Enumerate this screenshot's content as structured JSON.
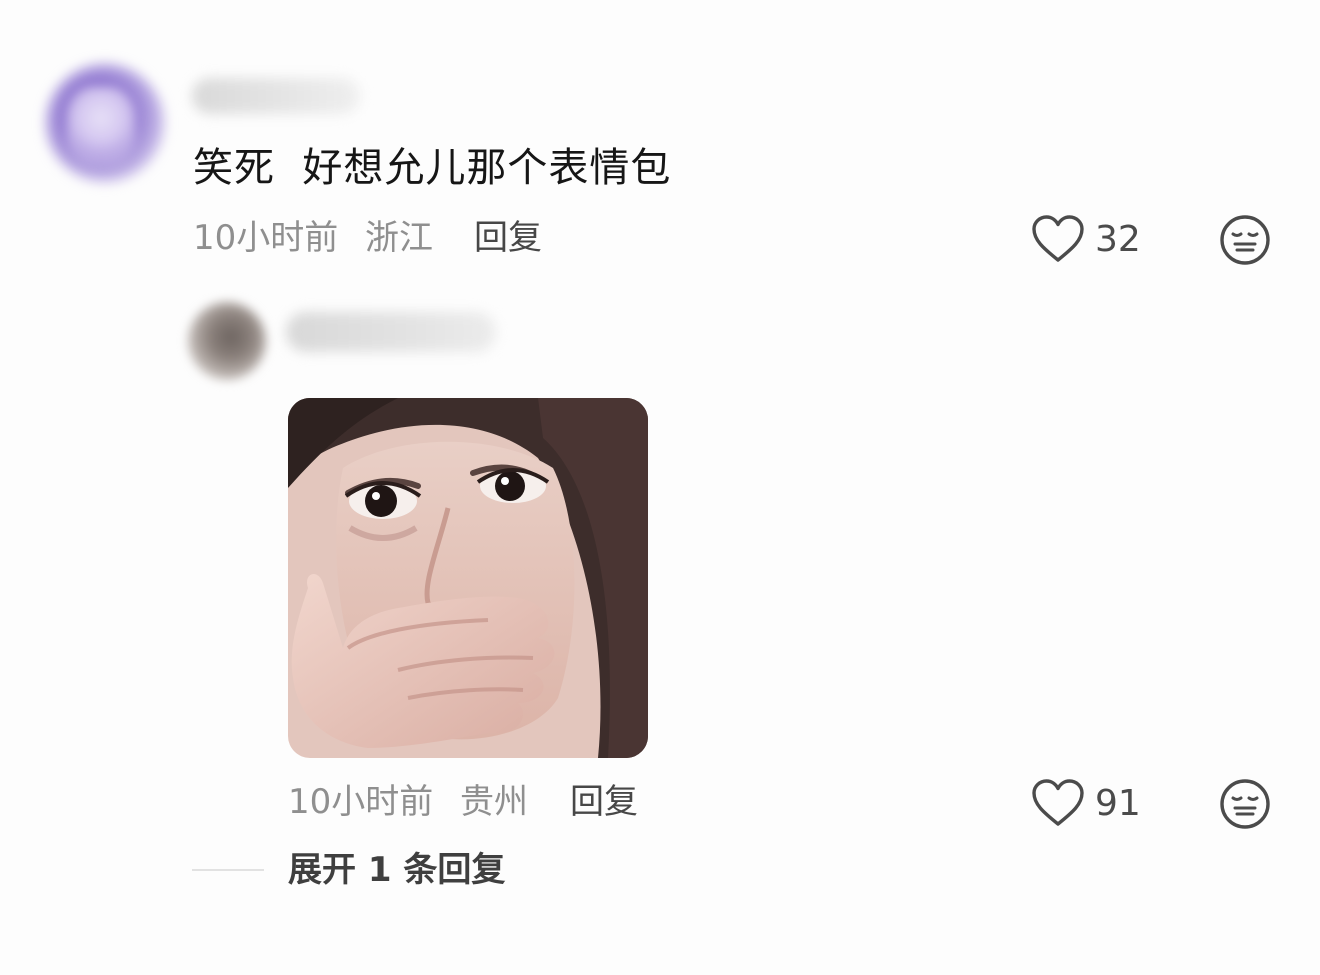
{
  "comment": {
    "text": "笑死  好想允儿那个表情包",
    "time": "10小时前",
    "location": "浙江",
    "reply_label": "回复",
    "likes": "32"
  },
  "reply": {
    "time": "10小时前",
    "location": "贵州",
    "reply_label": "回复",
    "likes": "91"
  },
  "expand": {
    "label": "展开 1 条回复"
  },
  "icons": {
    "like": "heart-outline-icon",
    "dislike": "meh-face-icon"
  },
  "colors": {
    "background": "#fdfdfd",
    "text_primary": "#161616",
    "text_meta": "#8f8f8f",
    "text_action": "#474747"
  }
}
